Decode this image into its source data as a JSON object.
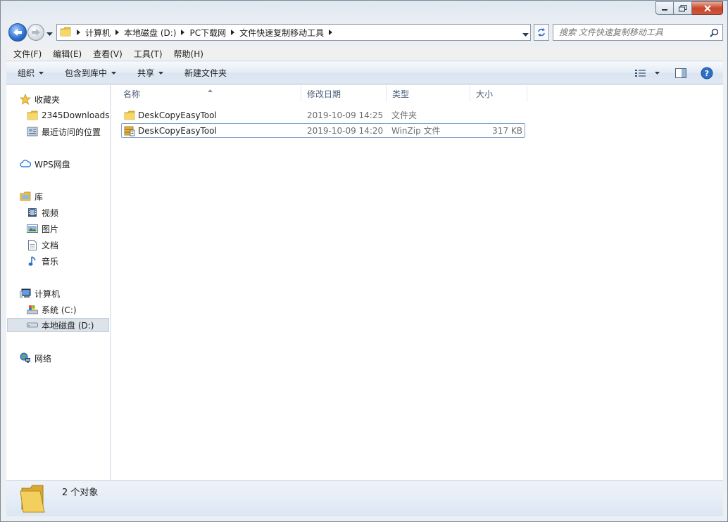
{
  "window": {
    "caption_buttons": [
      "minimize",
      "maximize",
      "close"
    ]
  },
  "address_bar": {
    "breadcrumbs": [
      "计算机",
      "本地磁盘 (D:)",
      "PC下载网",
      "文件快速复制移动工具"
    ]
  },
  "search": {
    "placeholder": "搜索 文件快速复制移动工具"
  },
  "menubar": {
    "items": [
      "文件(F)",
      "编辑(E)",
      "查看(V)",
      "工具(T)",
      "帮助(H)"
    ]
  },
  "commandbar": {
    "organize": "组织",
    "include_in_library": "包含到库中",
    "share": "共享",
    "new_folder": "新建文件夹"
  },
  "navpane": {
    "favorites": "收藏夹",
    "favorites_items": [
      "2345Downloads",
      "最近访问的位置"
    ],
    "wps": "WPS网盘",
    "libraries": "库",
    "library_items": [
      "视频",
      "图片",
      "文档",
      "音乐"
    ],
    "computer": "计算机",
    "computer_items": [
      "系统 (C:)",
      "本地磁盘 (D:)"
    ],
    "network": "网络"
  },
  "columns": {
    "name": "名称",
    "modified": "修改日期",
    "type": "类型",
    "size": "大小"
  },
  "files": [
    {
      "name": "DeskCopyEasyTool",
      "modified": "2019-10-09 14:25",
      "type": "文件夹",
      "size": "",
      "icon": "folder-icon"
    },
    {
      "name": "DeskCopyEasyTool",
      "modified": "2019-10-09 14:20",
      "type": "WinZip 文件",
      "size": "317 KB",
      "icon": "zip-archive-icon"
    }
  ],
  "status": {
    "count": "2 个对象"
  },
  "colors": {
    "accent_blue": "#2a6ed1",
    "folder_yellow": "#f0c94a",
    "close_red": "#c7482c"
  }
}
